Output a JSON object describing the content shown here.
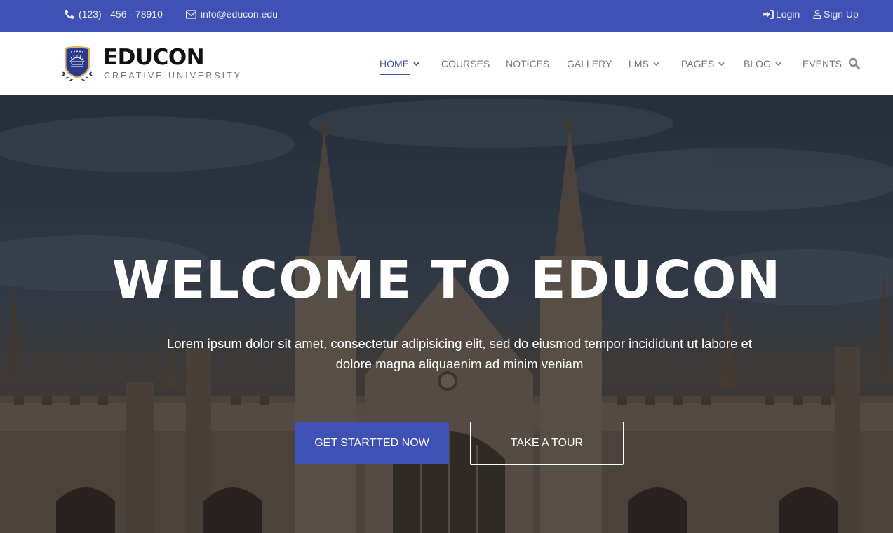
{
  "topbar": {
    "phone": "(123) - 456 - 78910",
    "email": "info@educon.edu",
    "login_label": "Login",
    "signup_label": "Sign Up",
    "icons": {
      "phone": "phone-icon",
      "email": "envelope-icon",
      "login": "sign-in-icon",
      "signup": "user-icon"
    }
  },
  "brand": {
    "name": "EDUCON",
    "tagline": "CREATIVE UNIVERSITY",
    "logo": "university-shield-logo"
  },
  "nav": {
    "items": [
      {
        "label": "HOME",
        "dropdown": true,
        "active": true
      },
      {
        "label": "COURSES",
        "dropdown": false,
        "active": false
      },
      {
        "label": "NOTICES",
        "dropdown": false,
        "active": false
      },
      {
        "label": "GALLERY",
        "dropdown": false,
        "active": false
      },
      {
        "label": "LMS",
        "dropdown": true,
        "active": false
      },
      {
        "label": "PAGES",
        "dropdown": true,
        "active": false
      },
      {
        "label": "BLOG",
        "dropdown": true,
        "active": false
      },
      {
        "label": "EVENTS",
        "dropdown": false,
        "active": false
      }
    ],
    "search_icon": "search-icon"
  },
  "hero": {
    "title": "WELCOME TO EDUCON",
    "text": "Lorem ipsum dolor sit amet, consectetur adipisicing elit, sed do eiusmod tempor incididunt ut labore et dolore magna aliquaenim ad minim veniam",
    "primary_button": "GET STARTTED NOW",
    "secondary_button": "TAKE A TOUR",
    "background": "gothic-university-building-photo"
  },
  "colors": {
    "brand": "#3f51b5",
    "nav_text": "#777777",
    "white": "#ffffff"
  }
}
